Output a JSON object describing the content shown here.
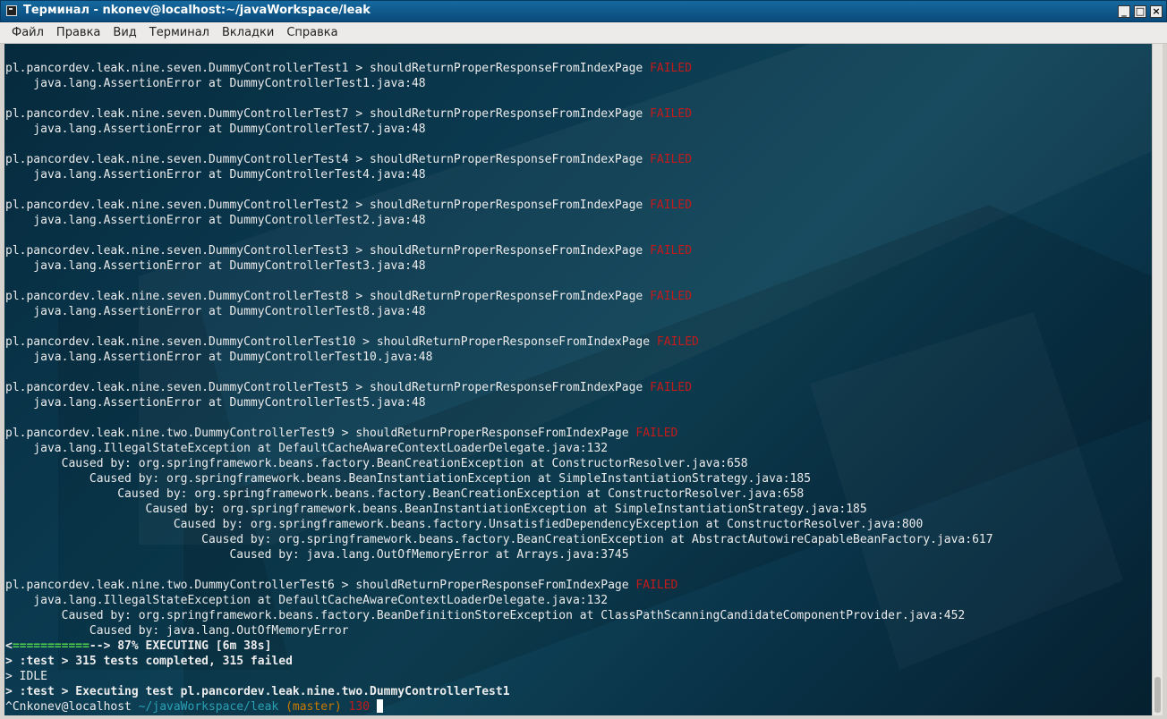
{
  "window": {
    "title": "Терминал - nkonev@localhost:~/javaWorkspace/leak",
    "buttons": {
      "minimize": "_",
      "maximize": "□",
      "close": "×"
    }
  },
  "menubar": {
    "items": [
      "Файл",
      "Правка",
      "Вид",
      "Терминал",
      "Вкладки",
      "Справка"
    ]
  },
  "terminal": {
    "lines": [
      {
        "text": "pl.pancordev.leak.nine.seven.DummyControllerTest1 > shouldReturnProperResponseFromIndexPage ",
        "suffix": "FAILED"
      },
      {
        "text": "    java.lang.AssertionError at DummyControllerTest1.java:48"
      },
      {
        "text": ""
      },
      {
        "text": "pl.pancordev.leak.nine.seven.DummyControllerTest7 > shouldReturnProperResponseFromIndexPage ",
        "suffix": "FAILED"
      },
      {
        "text": "    java.lang.AssertionError at DummyControllerTest7.java:48"
      },
      {
        "text": ""
      },
      {
        "text": "pl.pancordev.leak.nine.seven.DummyControllerTest4 > shouldReturnProperResponseFromIndexPage ",
        "suffix": "FAILED"
      },
      {
        "text": "    java.lang.AssertionError at DummyControllerTest4.java:48"
      },
      {
        "text": ""
      },
      {
        "text": "pl.pancordev.leak.nine.seven.DummyControllerTest2 > shouldReturnProperResponseFromIndexPage ",
        "suffix": "FAILED"
      },
      {
        "text": "    java.lang.AssertionError at DummyControllerTest2.java:48"
      },
      {
        "text": ""
      },
      {
        "text": "pl.pancordev.leak.nine.seven.DummyControllerTest3 > shouldReturnProperResponseFromIndexPage ",
        "suffix": "FAILED"
      },
      {
        "text": "    java.lang.AssertionError at DummyControllerTest3.java:48"
      },
      {
        "text": ""
      },
      {
        "text": "pl.pancordev.leak.nine.seven.DummyControllerTest8 > shouldReturnProperResponseFromIndexPage ",
        "suffix": "FAILED"
      },
      {
        "text": "    java.lang.AssertionError at DummyControllerTest8.java:48"
      },
      {
        "text": ""
      },
      {
        "text": "pl.pancordev.leak.nine.seven.DummyControllerTest10 > shouldReturnProperResponseFromIndexPage ",
        "suffix": "FAILED"
      },
      {
        "text": "    java.lang.AssertionError at DummyControllerTest10.java:48"
      },
      {
        "text": ""
      },
      {
        "text": "pl.pancordev.leak.nine.seven.DummyControllerTest5 > shouldReturnProperResponseFromIndexPage ",
        "suffix": "FAILED"
      },
      {
        "text": "    java.lang.AssertionError at DummyControllerTest5.java:48"
      },
      {
        "text": ""
      },
      {
        "text": "pl.pancordev.leak.nine.two.DummyControllerTest9 > shouldReturnProperResponseFromIndexPage ",
        "suffix": "FAILED"
      },
      {
        "text": "    java.lang.IllegalStateException at DefaultCacheAwareContextLoaderDelegate.java:132"
      },
      {
        "text": "        Caused by: org.springframework.beans.factory.BeanCreationException at ConstructorResolver.java:658"
      },
      {
        "text": "            Caused by: org.springframework.beans.BeanInstantiationException at SimpleInstantiationStrategy.java:185"
      },
      {
        "text": "                Caused by: org.springframework.beans.factory.BeanCreationException at ConstructorResolver.java:658"
      },
      {
        "text": "                    Caused by: org.springframework.beans.BeanInstantiationException at SimpleInstantiationStrategy.java:185"
      },
      {
        "text": "                        Caused by: org.springframework.beans.factory.UnsatisfiedDependencyException at ConstructorResolver.java:800"
      },
      {
        "text": "                            Caused by: org.springframework.beans.factory.BeanCreationException at AbstractAutowireCapableBeanFactory.java:617"
      },
      {
        "text": "                                Caused by: java.lang.OutOfMemoryError at Arrays.java:3745"
      },
      {
        "text": ""
      },
      {
        "text": "pl.pancordev.leak.nine.two.DummyControllerTest6 > shouldReturnProperResponseFromIndexPage ",
        "suffix": "FAILED"
      },
      {
        "text": "    java.lang.IllegalStateException at DefaultCacheAwareContextLoaderDelegate.java:132"
      },
      {
        "text": "        Caused by: org.springframework.beans.factory.BeanDefinitionStoreException at ClassPathScanningCandidateComponentProvider.java:452"
      },
      {
        "text": "            Caused by: java.lang.OutOfMemoryError"
      }
    ],
    "progress": {
      "bar_open": "<",
      "bar_fill": "===========",
      "bar_rest": "--> 87% EXECUTING [6m 38s]",
      "percent": 87
    },
    "status_lines": [
      "> :test > 315 tests completed, 315 failed",
      "> IDLE",
      "> :test > Executing test pl.pancordev.leak.nine.two.DummyControllerTest1"
    ],
    "prompt": {
      "prefix": "^Cnkonev@localhost",
      "path": " ~/javaWorkspace/leak",
      "branch": " (master)",
      "exit_code": " 130",
      "trail": " "
    }
  },
  "colors": {
    "failed": "#c41a1a",
    "progress_green": "#4fd34f",
    "path": "#2aa1b3",
    "branch": "#c97a00"
  }
}
